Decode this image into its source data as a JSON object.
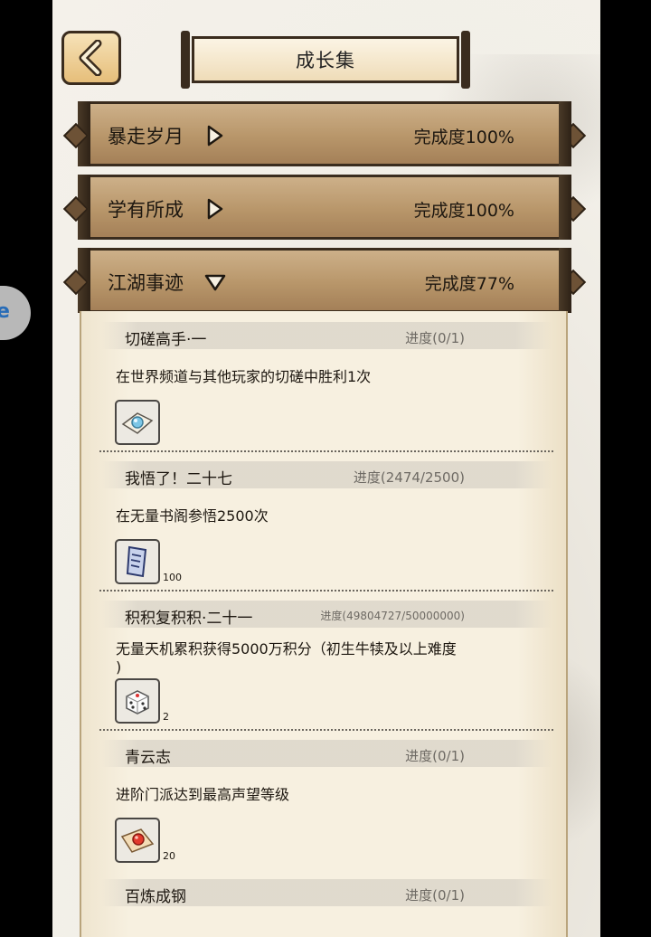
{
  "header": {
    "title": "成长集",
    "back_label": "返回"
  },
  "categories": [
    {
      "name": "暴走岁月",
      "completion": "完成度100%",
      "expanded": false
    },
    {
      "name": "学有所成",
      "completion": "完成度100%",
      "expanded": false
    },
    {
      "name": "江湖事迹",
      "completion": "完成度77%",
      "expanded": true
    }
  ],
  "tasks": [
    {
      "name": "切磋高手·一",
      "progress": "进度(0/1)",
      "desc": "在世界频道与其他玩家的切磋中胜利1次",
      "reward_icon": "scroll-orb-icon",
      "qty": ""
    },
    {
      "name": "我悟了！二十七",
      "progress": "进度(2474/2500)",
      "desc": "在无量书阁参悟2500次",
      "reward_icon": "talisman-card-icon",
      "qty": "100"
    },
    {
      "name": "积积复积积·二十一",
      "progress": "进度(49804727/50000000)",
      "desc": "无量天机累积获得5000万积分（初生牛犊及以上难度",
      "desc2": ")",
      "reward_icon": "dice-icon",
      "qty": "2"
    },
    {
      "name": "青云志",
      "progress": "进度(0/1)",
      "desc": "进阶门派达到最高声望等级",
      "reward_icon": "red-orb-scroll-icon",
      "qty": "20"
    },
    {
      "name": "百炼成钢",
      "progress": "进度(0/1)"
    }
  ],
  "side_badge": {
    "label": "e"
  },
  "colors": {
    "header_wood": "#b8966a",
    "panel_paper": "#f7f0e0",
    "ink": "#1d1710",
    "progress_gray": "#6e6a64"
  }
}
